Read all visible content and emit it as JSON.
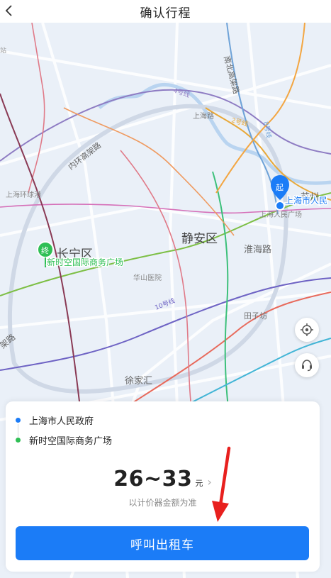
{
  "header": {
    "title": "确认行程",
    "back_icon": "chevron-left-icon"
  },
  "map": {
    "district_labels": [
      "长宁区",
      "静安区"
    ],
    "road_labels": [
      "内环高架路",
      "南北高架路",
      "上海路",
      "淮海路",
      "田子坊",
      "上海环球港",
      "华山医院",
      "徐家汇",
      "上海人民广场",
      "苏州",
      "架路",
      "站"
    ],
    "metro_labels": [
      "4号线",
      "2号线",
      "8号线",
      "10号线"
    ],
    "start_marker": {
      "label": "起",
      "text": "上海市人民"
    },
    "end_marker": {
      "label": "终",
      "text": "新时空国际商务广场"
    },
    "controls": [
      "locate-icon",
      "headset-icon"
    ]
  },
  "trip": {
    "origin": "上海市人民政府",
    "destination": "新时空国际商务广场",
    "origin_color": "#1b7cf7",
    "destination_color": "#2fbf55"
  },
  "fare": {
    "amount": "26~33",
    "unit": "元",
    "note": "以计价器金额为准"
  },
  "action": {
    "call_label": "呼叫出租车",
    "color": "#1b7cf7"
  },
  "annotation": {
    "arrow_color": "#e8201e"
  }
}
